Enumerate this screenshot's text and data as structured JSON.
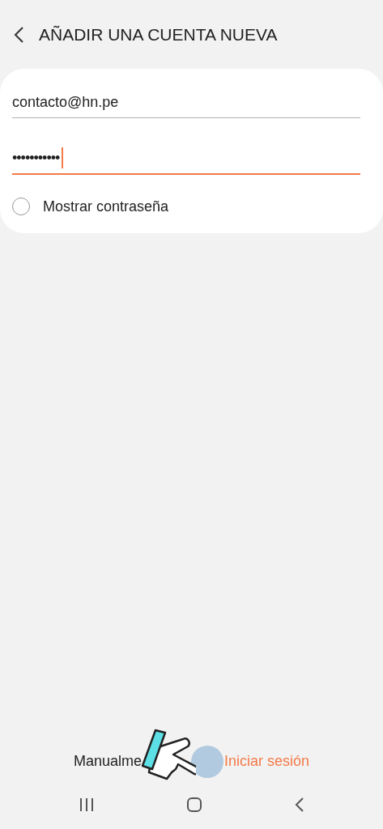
{
  "header": {
    "title": "AÑADIR UNA CUENTA NUEVA"
  },
  "form": {
    "email": {
      "value": "contacto@hn.pe",
      "focused": false
    },
    "password": {
      "value": "•••••••••••",
      "focused": true
    },
    "show_password": {
      "label": "Mostrar contraseña",
      "checked": false
    }
  },
  "actions": [
    {
      "label": "Manualme",
      "kind": "secondary"
    },
    {
      "label": "Iniciar sesión",
      "kind": "primary"
    }
  ],
  "tap_hint": {
    "visible": true
  }
}
